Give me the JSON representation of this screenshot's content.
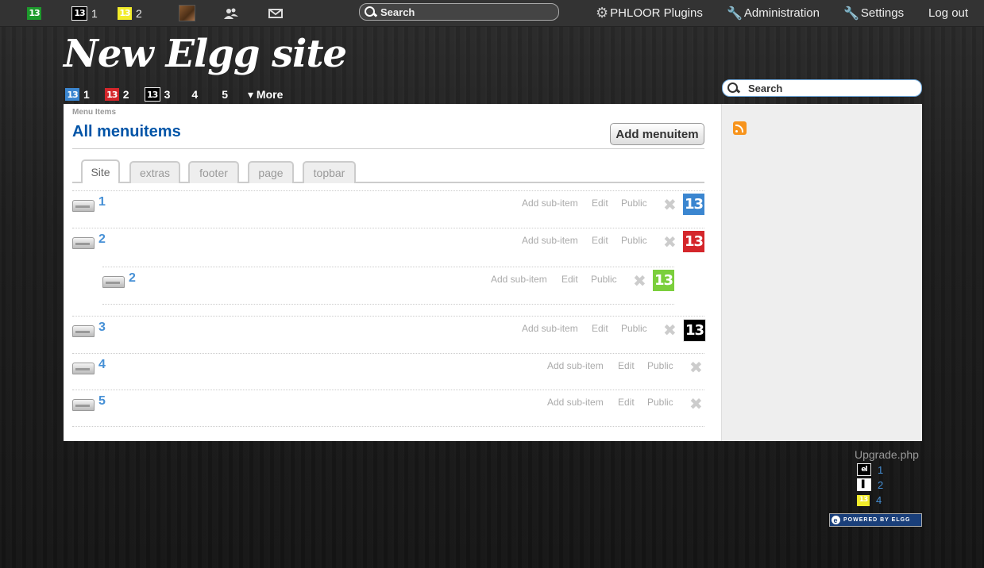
{
  "topbar": {
    "badges": [
      {
        "icon": "thirteen-green-icon",
        "count": ""
      },
      {
        "icon": "thirteen-black-icon",
        "count": "1"
      },
      {
        "icon": "thirteen-yellow-icon",
        "count": "2"
      }
    ],
    "search_placeholder": "Search",
    "plugins_label": "PHLOOR Plugins",
    "admin_label": "Administration",
    "settings_label": "Settings",
    "logout_label": "Log out"
  },
  "header": {
    "site_title": "New Elgg site",
    "menu": [
      {
        "label": "1",
        "icon": "thirteen-blue-icon"
      },
      {
        "label": "2",
        "icon": "thirteen-red-icon"
      },
      {
        "label": "3",
        "icon": "thirteen-black-icon"
      },
      {
        "label": "4"
      },
      {
        "label": "5"
      }
    ],
    "more_label": "▾ More",
    "search_placeholder": "Search"
  },
  "main": {
    "breadcrumb": "Menu Items",
    "title": "All menuitems",
    "add_button": "Add menuitem",
    "tabs": [
      "Site",
      "extras",
      "footer",
      "page",
      "topbar"
    ],
    "active_tab": "Site",
    "rows": [
      {
        "name": "1",
        "add_sub": "Add sub-item",
        "edit": "Edit",
        "access": "Public",
        "icon": "thirteen-blue-icon"
      },
      {
        "name": "2",
        "add_sub": "Add sub-item",
        "edit": "Edit",
        "access": "Public",
        "icon": "thirteen-red-icon"
      },
      {
        "name": "2",
        "add_sub": "Add sub-item",
        "edit": "Edit",
        "access": "Public",
        "icon": "thirteen-lime-icon"
      },
      {
        "name": "3",
        "add_sub": "Add sub-item",
        "edit": "Edit",
        "access": "Public",
        "icon": "thirteen-black-icon"
      },
      {
        "name": "4",
        "add_sub": "Add sub-item",
        "edit": "Edit",
        "access": "Public"
      },
      {
        "name": "5",
        "add_sub": "Add sub-item",
        "edit": "Edit",
        "access": "Public"
      }
    ]
  },
  "footer": {
    "upgrade": "Upgrade.php",
    "items": [
      {
        "label": "1",
        "icon": "elgg-logo-icon"
      },
      {
        "label": "2",
        "icon": "page-icon"
      },
      {
        "label": "4",
        "icon": "thirteen-yellow-icon"
      }
    ],
    "powered": "POWERED BY ELGG"
  },
  "colors": {
    "link": "#4690d6",
    "title": "#0054a7",
    "topbar": "#333333"
  }
}
